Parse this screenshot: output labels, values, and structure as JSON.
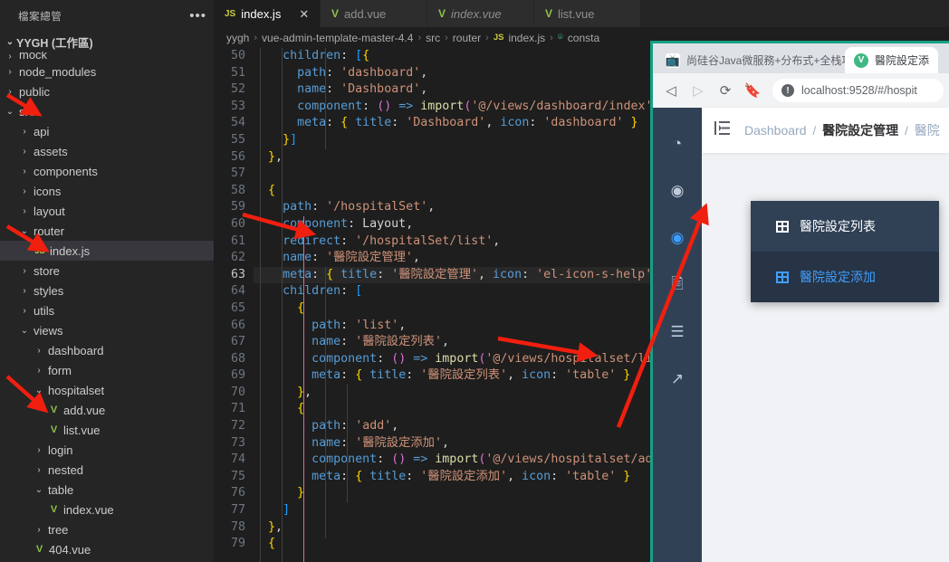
{
  "vscode": {
    "sidebar": {
      "title": "檔案總管",
      "more_icon": "•••",
      "workspace": "YYGH (工作區)",
      "tree": [
        {
          "label": "mock",
          "indent": 1,
          "kind": "folder",
          "state": "collapsed",
          "cut": true
        },
        {
          "label": "node_modules",
          "indent": 1,
          "kind": "folder",
          "state": "collapsed"
        },
        {
          "label": "public",
          "indent": 1,
          "kind": "folder",
          "state": "collapsed"
        },
        {
          "label": "src",
          "indent": 1,
          "kind": "folder",
          "state": "expanded"
        },
        {
          "label": "api",
          "indent": 2,
          "kind": "folder",
          "state": "collapsed"
        },
        {
          "label": "assets",
          "indent": 2,
          "kind": "folder",
          "state": "collapsed"
        },
        {
          "label": "components",
          "indent": 2,
          "kind": "folder",
          "state": "collapsed"
        },
        {
          "label": "icons",
          "indent": 2,
          "kind": "folder",
          "state": "collapsed"
        },
        {
          "label": "layout",
          "indent": 2,
          "kind": "folder",
          "state": "collapsed"
        },
        {
          "label": "router",
          "indent": 2,
          "kind": "folder",
          "state": "expanded"
        },
        {
          "label": "index.js",
          "indent": 3,
          "kind": "js",
          "selected": true
        },
        {
          "label": "store",
          "indent": 2,
          "kind": "folder",
          "state": "collapsed"
        },
        {
          "label": "styles",
          "indent": 2,
          "kind": "folder",
          "state": "collapsed"
        },
        {
          "label": "utils",
          "indent": 2,
          "kind": "folder",
          "state": "collapsed"
        },
        {
          "label": "views",
          "indent": 2,
          "kind": "folder",
          "state": "expanded"
        },
        {
          "label": "dashboard",
          "indent": 3,
          "kind": "folder",
          "state": "collapsed"
        },
        {
          "label": "form",
          "indent": 3,
          "kind": "folder",
          "state": "collapsed"
        },
        {
          "label": "hospitalset",
          "indent": 3,
          "kind": "folder",
          "state": "expanded"
        },
        {
          "label": "add.vue",
          "indent": 4,
          "kind": "vue"
        },
        {
          "label": "list.vue",
          "indent": 4,
          "kind": "vue"
        },
        {
          "label": "login",
          "indent": 3,
          "kind": "folder",
          "state": "collapsed"
        },
        {
          "label": "nested",
          "indent": 3,
          "kind": "folder",
          "state": "collapsed"
        },
        {
          "label": "table",
          "indent": 3,
          "kind": "folder",
          "state": "expanded"
        },
        {
          "label": "index.vue",
          "indent": 4,
          "kind": "vue"
        },
        {
          "label": "tree",
          "indent": 3,
          "kind": "folder",
          "state": "collapsed"
        },
        {
          "label": "404.vue",
          "indent": 3,
          "kind": "vue"
        }
      ]
    },
    "tabs": [
      {
        "label": "index.js",
        "icon": "js-file-icon",
        "active": true,
        "italic": false,
        "closable": true
      },
      {
        "label": "add.vue",
        "icon": "vue-file-icon",
        "active": false,
        "italic": false
      },
      {
        "label": "index.vue",
        "icon": "vue-file-icon",
        "active": false,
        "italic": true
      },
      {
        "label": "list.vue",
        "icon": "vue-file-icon",
        "active": false,
        "italic": false
      }
    ],
    "tab_close_glyph": "✕",
    "breadcrumb": [
      "yygh",
      "vue-admin-template-master-4.4",
      "src",
      "router",
      "index.js",
      "consta"
    ],
    "breadcrumb_separator": "›",
    "editor": {
      "current_line": 63,
      "first_line": 50,
      "lines": [
        {
          "n": 50,
          "t": "    children: [{"
        },
        {
          "n": 51,
          "t": "      path: 'dashboard',"
        },
        {
          "n": 52,
          "t": "      name: 'Dashboard',"
        },
        {
          "n": 53,
          "t": "      component: () => import('@/views/dashboard/index'),"
        },
        {
          "n": 54,
          "t": "      meta: { title: 'Dashboard', icon: 'dashboard' }"
        },
        {
          "n": 55,
          "t": "    }]"
        },
        {
          "n": 56,
          "t": "  },"
        },
        {
          "n": 57,
          "t": ""
        },
        {
          "n": 58,
          "t": "  {"
        },
        {
          "n": 59,
          "t": "    path: '/hospitalSet',"
        },
        {
          "n": 60,
          "t": "    component: Layout,"
        },
        {
          "n": 61,
          "t": "    redirect: '/hospitalSet/list',"
        },
        {
          "n": 62,
          "t": "    name: '醫院設定管理',"
        },
        {
          "n": 63,
          "t": "    meta: { title: '醫院設定管理', icon: 'el-icon-s-help' }"
        },
        {
          "n": 64,
          "t": "    children: ["
        },
        {
          "n": 65,
          "t": "      {"
        },
        {
          "n": 66,
          "t": "        path: 'list',"
        },
        {
          "n": 67,
          "t": "        name: '醫院設定列表',"
        },
        {
          "n": 68,
          "t": "        component: () => import('@/views/hospitalset/list')"
        },
        {
          "n": 69,
          "t": "        meta: { title: '醫院設定列表', icon: 'table' }"
        },
        {
          "n": 70,
          "t": "      },"
        },
        {
          "n": 71,
          "t": "      {"
        },
        {
          "n": 72,
          "t": "        path: 'add',"
        },
        {
          "n": 73,
          "t": "        name: '醫院設定添加',"
        },
        {
          "n": 74,
          "t": "        component: () => import('@/views/hospitalset/add'),"
        },
        {
          "n": 75,
          "t": "        meta: { title: '醫院設定添加', icon: 'table' }"
        },
        {
          "n": 76,
          "t": "      }"
        },
        {
          "n": 77,
          "t": "    ]"
        },
        {
          "n": 78,
          "t": "  },"
        },
        {
          "n": 79,
          "t": "  {"
        }
      ]
    }
  },
  "browser": {
    "tabs": [
      {
        "title": "尚硅谷Java微服務+分布式+全栈項目",
        "favicon": "bilibili-icon",
        "active": false
      },
      {
        "title": "醫院設定添",
        "favicon": "vue-icon",
        "active": true
      }
    ],
    "toolbar": {
      "back_icon": "back-arrow-icon",
      "forward_icon": "forward-arrow-icon",
      "reload_icon": "reload-icon",
      "bookmark_icon": "bookmark-icon",
      "security_icon": "not-secure-icon",
      "url": "localhost:9528/#/hospit"
    },
    "app": {
      "aside_icons": [
        {
          "name": "dashboard-icon",
          "glyph": "◔",
          "active": false
        },
        {
          "name": "help-circle-icon",
          "glyph": "◉",
          "active": false
        },
        {
          "name": "help-circle-icon-active",
          "glyph": "◉",
          "active": true
        },
        {
          "name": "form-icon",
          "glyph": "🖹",
          "active": false
        },
        {
          "name": "list-icon",
          "glyph": "☰",
          "active": false
        },
        {
          "name": "external-link-icon",
          "glyph": "↗",
          "active": false
        }
      ],
      "hamburger_icon": "hamburger-icon",
      "breadcrumb": [
        {
          "label": "Dashboard",
          "state": "link"
        },
        {
          "label": "醫院設定管理",
          "state": "current"
        },
        {
          "label": "醫院",
          "state": "link"
        }
      ],
      "breadcrumb_separator": "/",
      "submenu": [
        {
          "label": "醫院設定列表",
          "icon": "table-icon",
          "highlighted": false
        },
        {
          "label": "醫院設定添加",
          "icon": "table-icon",
          "highlighted": true
        }
      ]
    }
  },
  "colors": {
    "vscode_bg": "#1e1e1e",
    "sidebar_bg": "#252526",
    "selection": "#37373d",
    "arrow_red": "#f01f0f",
    "browser_border": "#16a085",
    "app_aside": "#304156",
    "accent_blue": "#409eff"
  }
}
